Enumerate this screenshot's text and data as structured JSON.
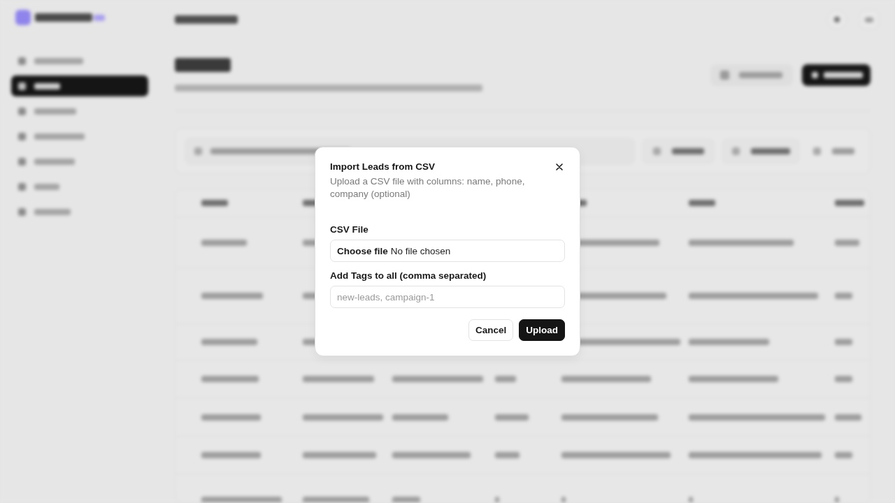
{
  "dialog": {
    "title": "Import Leads from CSV",
    "description": "Upload a CSV file with columns: name, phone, company (optional)",
    "fields": [
      {
        "kind": "file",
        "label": "CSV File",
        "button": "Choose file",
        "status": "No file chosen"
      },
      {
        "kind": "text",
        "label": "Add Tags to all (comma separated)",
        "placeholder": "new-leads, campaign-1"
      }
    ],
    "buttons": [
      {
        "kind": "secondary",
        "label": "Cancel"
      },
      {
        "kind": "primary",
        "label": "Upload"
      }
    ]
  }
}
